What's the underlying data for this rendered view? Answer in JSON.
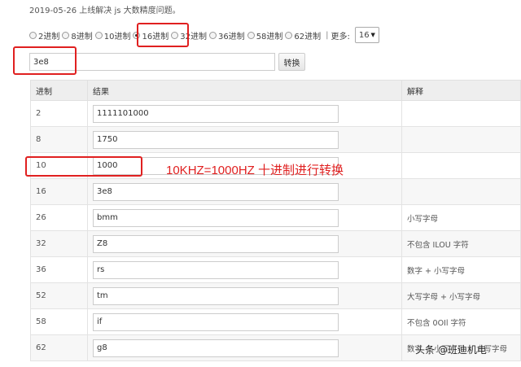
{
  "notice": "2019-05-26 上线解决 js 大数精度问题。",
  "radios": [
    {
      "label": "2进制",
      "checked": false
    },
    {
      "label": "8进制",
      "checked": false
    },
    {
      "label": "10进制",
      "checked": false
    },
    {
      "label": "16进制",
      "checked": true
    },
    {
      "label": "32进制",
      "checked": false
    },
    {
      "label": "36进制",
      "checked": false
    },
    {
      "label": "58进制",
      "checked": false
    },
    {
      "label": "62进制",
      "checked": false
    }
  ],
  "more": {
    "separator": "|",
    "label": "更多:",
    "selected": "16"
  },
  "input": {
    "value": "3e8"
  },
  "convert_label": "转换",
  "table": {
    "headers": [
      "进制",
      "结果",
      "解释"
    ],
    "rows": [
      {
        "base": "2",
        "result": "1111101000",
        "note": ""
      },
      {
        "base": "8",
        "result": "1750",
        "note": ""
      },
      {
        "base": "10",
        "result": "1000",
        "note": ""
      },
      {
        "base": "16",
        "result": "3e8",
        "note": ""
      },
      {
        "base": "26",
        "result": "bmm",
        "note": "小写字母"
      },
      {
        "base": "32",
        "result": "Z8",
        "note": "不包含 ILOU 字符"
      },
      {
        "base": "36",
        "result": "rs",
        "note": "数字 + 小写字母"
      },
      {
        "base": "52",
        "result": "tm",
        "note": "大写字母 + 小写字母"
      },
      {
        "base": "58",
        "result": "if",
        "note": "不包含 0OIl 字符"
      },
      {
        "base": "62",
        "result": "g8",
        "note": "数字 + 小写字母 + 大写字母"
      }
    ]
  },
  "annotation": "10KHZ=1000HZ 十进制进行转换",
  "watermark": "头条 @班迪机电",
  "colors": {
    "highlight": "#e02020",
    "header_bg": "#eeeeee"
  }
}
